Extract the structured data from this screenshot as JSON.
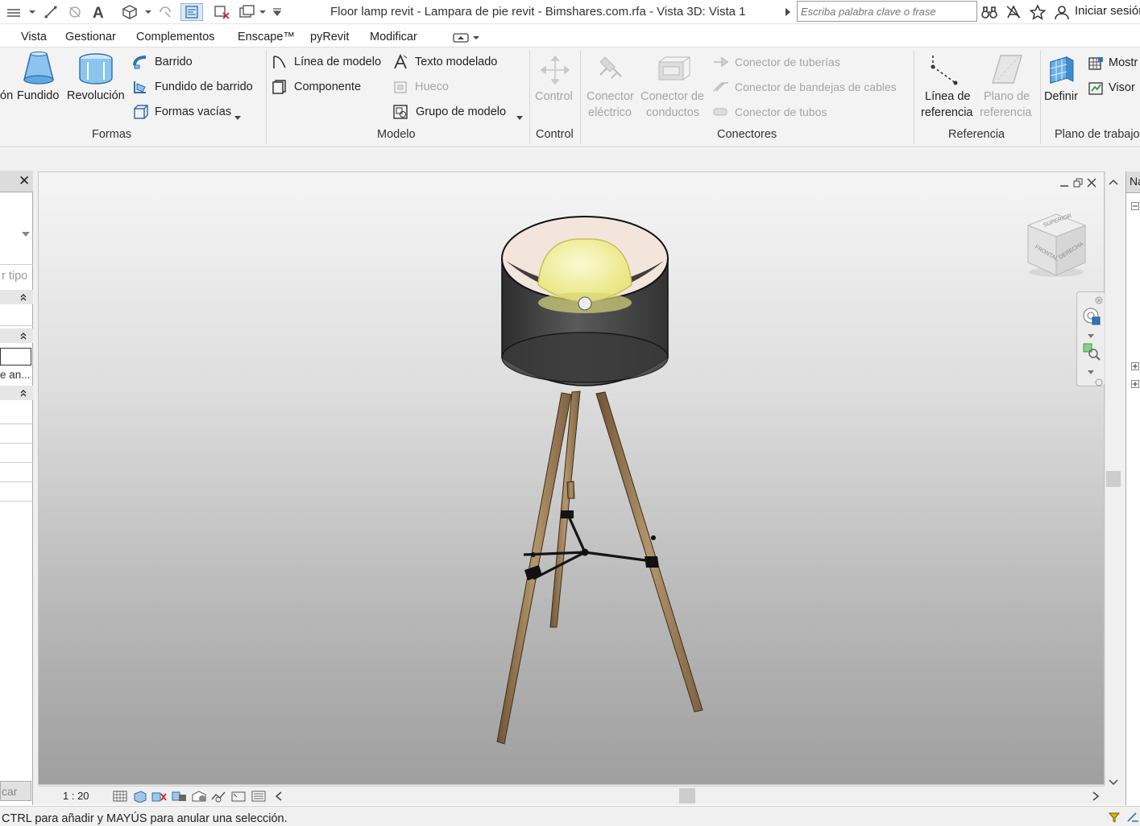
{
  "window": {
    "title": "Floor lamp revit - Lampara de pie revit - Bimshares.com.rfa - Vista 3D: Vista 1",
    "search_placeholder": "Escriba palabra clave o frase",
    "sign_in": "Iniciar sesión"
  },
  "menu": [
    "Vista",
    "Gestionar",
    "Complementos",
    "Enscape™",
    "pyRevit",
    "Modificar"
  ],
  "ribbon": {
    "formas": {
      "partial_label": "ón",
      "fundido": "Fundido",
      "revolucion": "Revolución",
      "barrido": "Barrido",
      "fundido_barrido": "Fundido de barrido",
      "formas_vacias": "Formas vacías",
      "panel": "Formas"
    },
    "modelo": {
      "linea_modelo": "Línea de modelo",
      "componente": "Componente",
      "texto_modelado": "Texto modelado",
      "hueco": "Hueco",
      "grupo_modelo": "Grupo de modelo",
      "panel": "Modelo"
    },
    "control": {
      "control_btn": "Control",
      "panel": "Control"
    },
    "conectores": {
      "electrico_1": "Conector",
      "electrico_2": "eléctrico",
      "conductos_1": "Conector de",
      "conductos_2": "conductos",
      "tuberias": "Conector de tuberías",
      "bandejas": "Conector de bandejas de cables",
      "tubos": "Conector de tubos",
      "panel": "Conectores"
    },
    "referencia": {
      "linea_1": "Línea de",
      "linea_2": "referencia",
      "plano_1": "Plano de",
      "plano_2": "referencia",
      "panel": "Referencia"
    },
    "plano_trabajo": {
      "definir": "Definir",
      "mostrar": "Mostr",
      "visor": "Visor",
      "panel": "Plano de trabajo"
    }
  },
  "properties": {
    "close": "✕",
    "type_filter": "r tipo",
    "row_text": "e an...",
    "apply_button": "car"
  },
  "viewcube": {
    "top": "SUPERIOR",
    "front": "FRONTAL",
    "right": "DERECHA"
  },
  "right_panel": {
    "header": "Na"
  },
  "view_bar": {
    "scale": "1 : 20"
  },
  "status": {
    "text": "CTRL para añadir y MAYÚS para anular una selección."
  },
  "colors": {
    "ribbon_bg": "#f3f3f3",
    "accent_blue": "#2e75b6",
    "lampshade": "#4a4a4a",
    "bulb": "#f0ee9c",
    "wood": "#9a7a50"
  }
}
